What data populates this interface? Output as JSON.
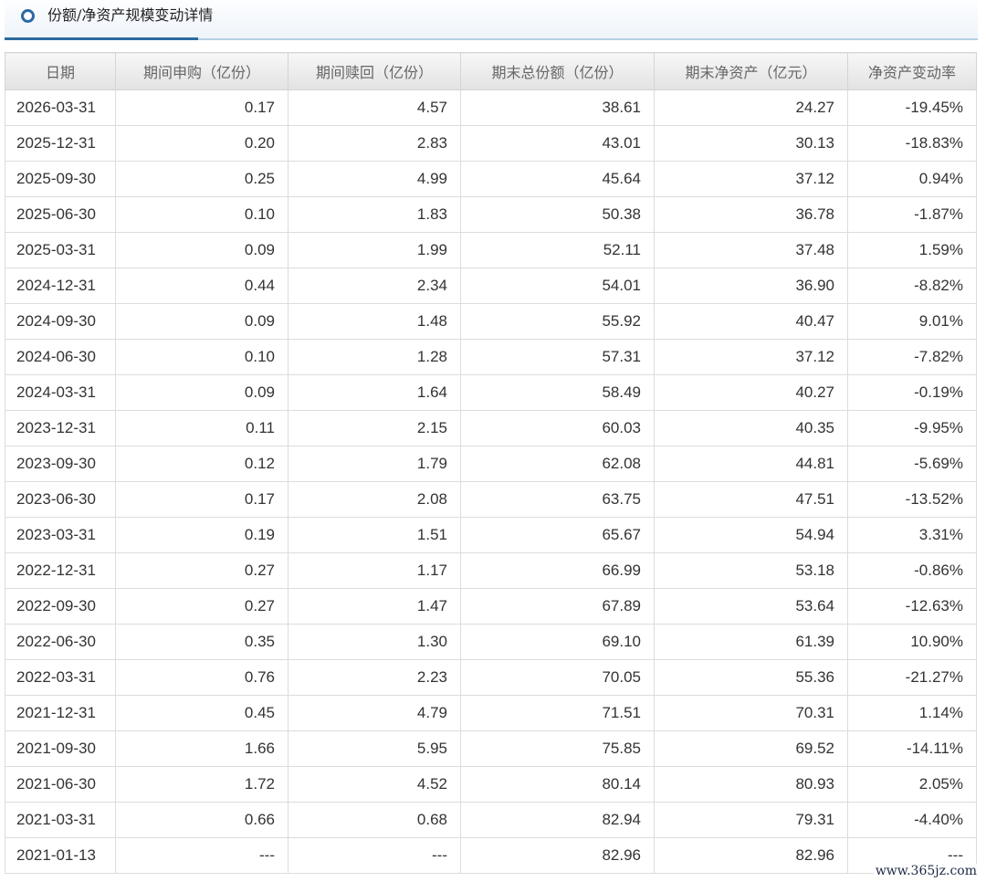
{
  "section": {
    "title": "份额/净资产规模变动详情",
    "icon": "circle-icon"
  },
  "table": {
    "headers": [
      "日期",
      "期间申购（亿份）",
      "期间赎回（亿份）",
      "期末总份额（亿份）",
      "期末净资产（亿元）",
      "净资产变动率"
    ],
    "rows": [
      [
        "2026-03-31",
        "0.17",
        "4.57",
        "38.61",
        "24.27",
        "-19.45%"
      ],
      [
        "2025-12-31",
        "0.20",
        "2.83",
        "43.01",
        "30.13",
        "-18.83%"
      ],
      [
        "2025-09-30",
        "0.25",
        "4.99",
        "45.64",
        "37.12",
        "0.94%"
      ],
      [
        "2025-06-30",
        "0.10",
        "1.83",
        "50.38",
        "36.78",
        "-1.87%"
      ],
      [
        "2025-03-31",
        "0.09",
        "1.99",
        "52.11",
        "37.48",
        "1.59%"
      ],
      [
        "2024-12-31",
        "0.44",
        "2.34",
        "54.01",
        "36.90",
        "-8.82%"
      ],
      [
        "2024-09-30",
        "0.09",
        "1.48",
        "55.92",
        "40.47",
        "9.01%"
      ],
      [
        "2024-06-30",
        "0.10",
        "1.28",
        "57.31",
        "37.12",
        "-7.82%"
      ],
      [
        "2024-03-31",
        "0.09",
        "1.64",
        "58.49",
        "40.27",
        "-0.19%"
      ],
      [
        "2023-12-31",
        "0.11",
        "2.15",
        "60.03",
        "40.35",
        "-9.95%"
      ],
      [
        "2023-09-30",
        "0.12",
        "1.79",
        "62.08",
        "44.81",
        "-5.69%"
      ],
      [
        "2023-06-30",
        "0.17",
        "2.08",
        "63.75",
        "47.51",
        "-13.52%"
      ],
      [
        "2023-03-31",
        "0.19",
        "1.51",
        "65.67",
        "54.94",
        "3.31%"
      ],
      [
        "2022-12-31",
        "0.27",
        "1.17",
        "66.99",
        "53.18",
        "-0.86%"
      ],
      [
        "2022-09-30",
        "0.27",
        "1.47",
        "67.89",
        "53.64",
        "-12.63%"
      ],
      [
        "2022-06-30",
        "0.35",
        "1.30",
        "69.10",
        "61.39",
        "10.90%"
      ],
      [
        "2022-03-31",
        "0.76",
        "2.23",
        "70.05",
        "55.36",
        "-21.27%"
      ],
      [
        "2021-12-31",
        "0.45",
        "4.79",
        "71.51",
        "70.31",
        "1.14%"
      ],
      [
        "2021-09-30",
        "1.66",
        "5.95",
        "75.85",
        "69.52",
        "-14.11%"
      ],
      [
        "2021-06-30",
        "1.72",
        "4.52",
        "80.14",
        "80.93",
        "2.05%"
      ],
      [
        "2021-03-31",
        "0.66",
        "0.68",
        "82.94",
        "79.31",
        "-4.40%"
      ],
      [
        "2021-01-13",
        "---",
        "---",
        "82.96",
        "82.96",
        "---"
      ]
    ]
  },
  "watermark": "www.365jz.com"
}
